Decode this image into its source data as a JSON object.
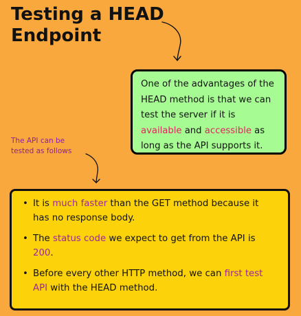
{
  "title": "Testing a HEAD Endpoint",
  "green_box": {
    "before": "One of the advantages of the HEAD method is that we can test the server if it is ",
    "highlight_1": "available",
    "middle": " and ",
    "highlight_2": "accessible",
    "after": " as long as the API supports it."
  },
  "note": "The API can be tested as follows",
  "bullets": [
    {
      "before": "It is ",
      "highlight": "much faster",
      "after": " than the GET method because it has no response body."
    },
    {
      "before": "The ",
      "highlight": "status code",
      "middle": " we expect to get from the API is ",
      "highlight_2": "200",
      "after": "."
    },
    {
      "before": "Before every other HTTP method, we can ",
      "highlight": "first test API",
      "after": " with the HEAD method."
    }
  ],
  "bullet_char": "•",
  "colors": {
    "background": "#F9A83E",
    "green_box": "#A7FB93",
    "yellow_box": "#FCD30B",
    "highlight_red": "#E0245E",
    "highlight_purple": "#A0239E",
    "note_text": "#8B1FA0"
  },
  "icons": [
    "curved-arrow-icon",
    "curved-arrow-icon"
  ]
}
